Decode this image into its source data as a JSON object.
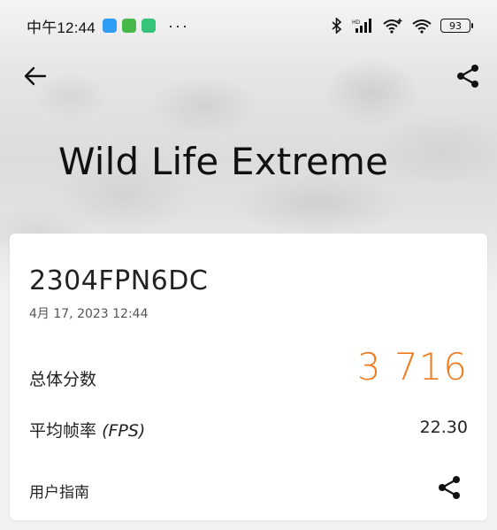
{
  "status_bar": {
    "time": "中午12:44",
    "notification_icons": [
      "app-blue-icon",
      "download-green-icon",
      "app-teal-icon"
    ],
    "more": "···",
    "battery": "93"
  },
  "header": {
    "back_icon": "arrow-left-icon",
    "share_icon": "share-icon",
    "title": "Wild Life Extreme"
  },
  "result": {
    "device": "2304FPN6DC",
    "date": "4月 17, 2023 12:44",
    "score_label": "总体分数",
    "score_value": "3 716",
    "fps_label_cn": "平均帧率",
    "fps_label_en": "(FPS)",
    "fps_value": "22.30",
    "guide_label": "用户指南",
    "guide_share_icon": "share-icon"
  },
  "colors": {
    "score": "#f07a1e",
    "card_bg": "#ffffff"
  }
}
